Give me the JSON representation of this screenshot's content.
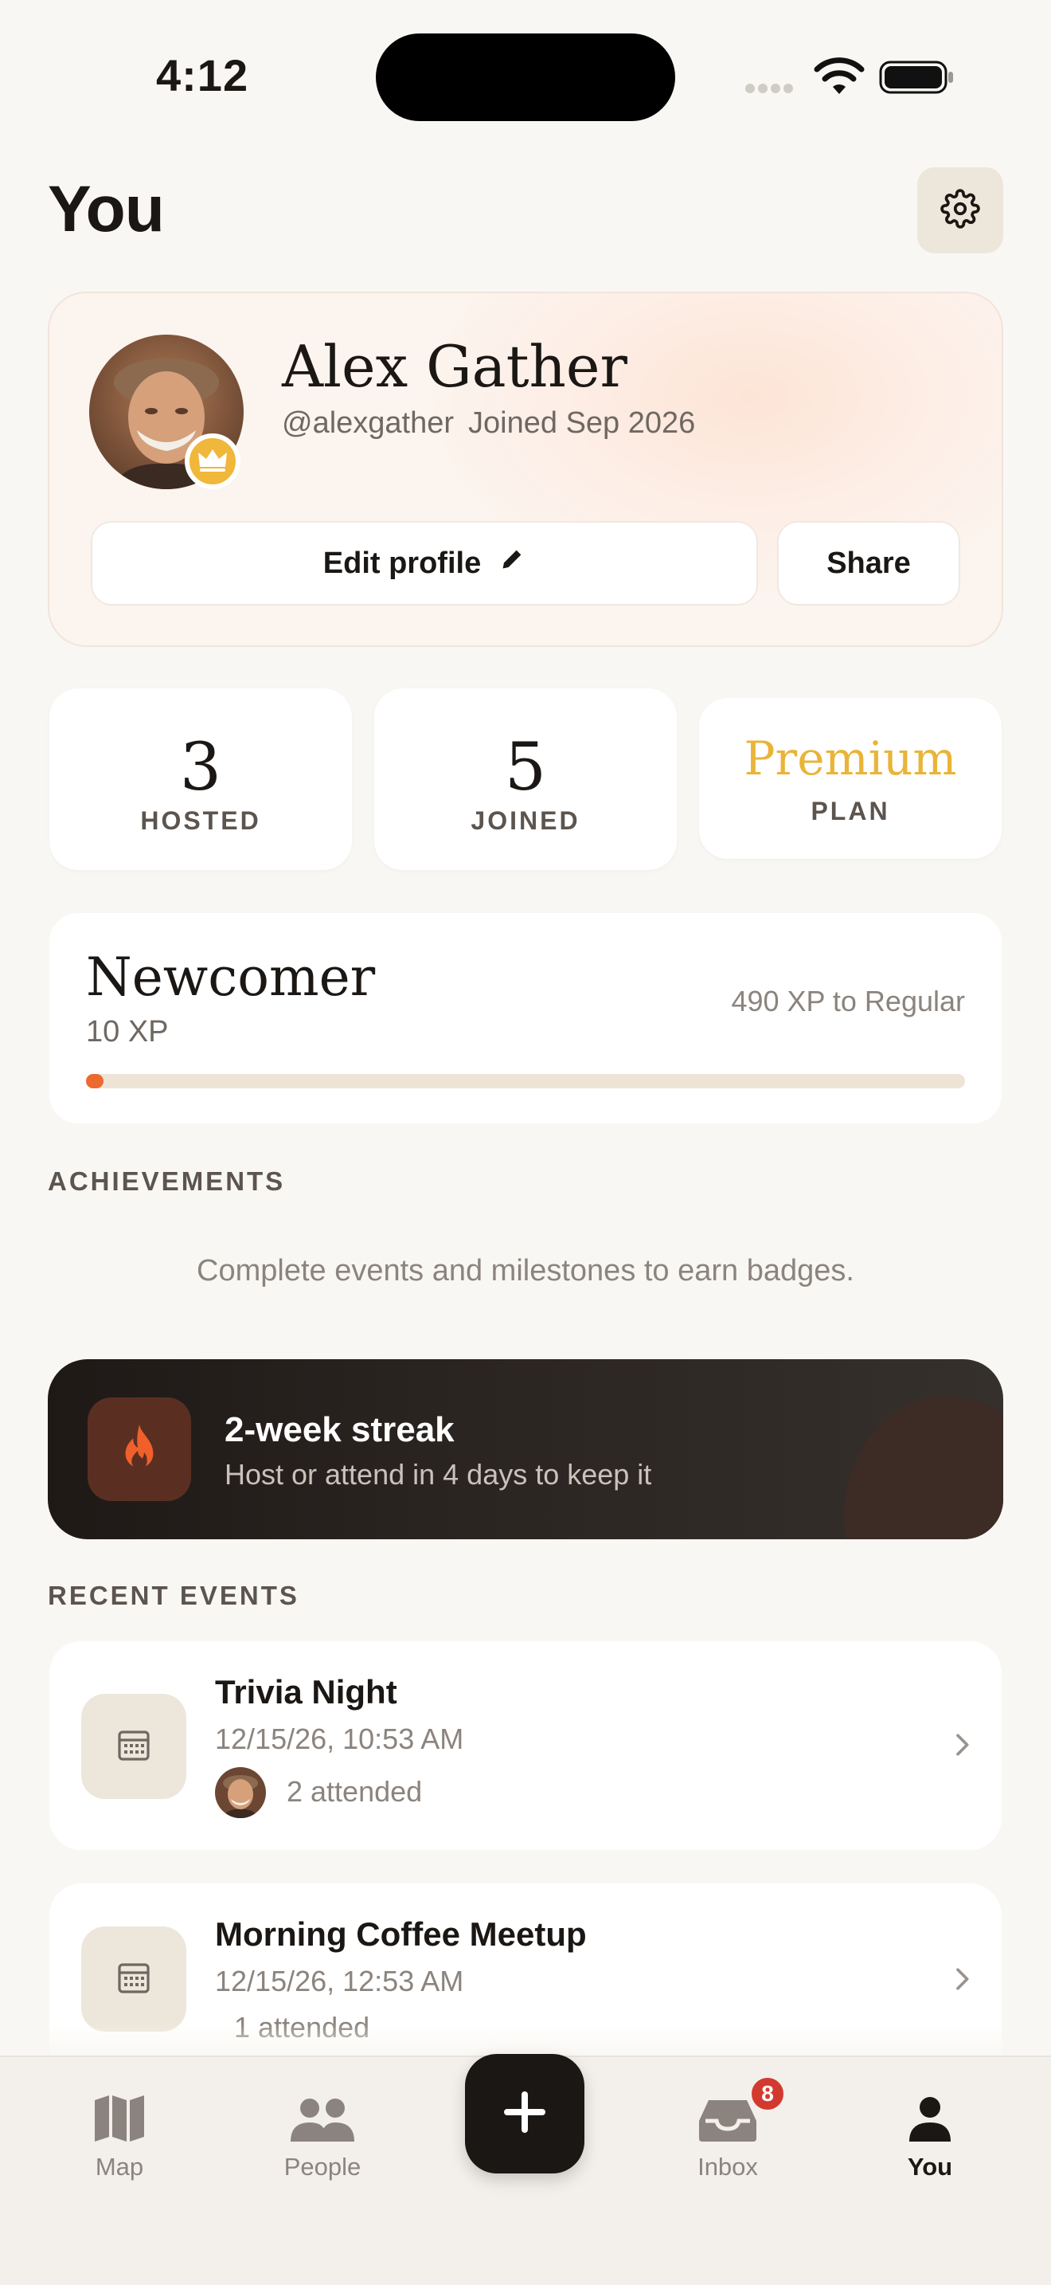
{
  "status_bar": {
    "time": "4:12"
  },
  "header": {
    "title": "You"
  },
  "profile": {
    "name": "Alex Gather",
    "handle": "@alexgather",
    "joined": "Joined Sep 2026",
    "edit_label": "Edit profile",
    "share_label": "Share"
  },
  "stats": [
    {
      "value": "3",
      "label": "HOSTED"
    },
    {
      "value": "5",
      "label": "JOINED"
    },
    {
      "value": "Premium",
      "label": "PLAN"
    }
  ],
  "level": {
    "name": "Newcomer",
    "xp": "10 XP",
    "next": "490 XP to Regular",
    "progress": 0.02
  },
  "achievements": {
    "label": "ACHIEVEMENTS",
    "empty_text": "Complete events and milestones to earn badges."
  },
  "streak": {
    "title": "2-week streak",
    "subtitle": "Host or attend in 4 days to keep it"
  },
  "recent": {
    "label": "RECENT EVENTS",
    "events": [
      {
        "title": "Trivia Night",
        "date": "12/15/26, 10:53 AM",
        "attended": "2 attended"
      },
      {
        "title": "Morning Coffee Meetup",
        "date": "12/15/26, 12:53 AM",
        "attended": "1 attended"
      }
    ]
  },
  "tabs": {
    "map": "Map",
    "people": "People",
    "inbox": "Inbox",
    "inbox_badge": "8",
    "you": "You"
  },
  "colors": {
    "accent": "#ec6a2e",
    "premium": "#e9b438",
    "badge": "#d33a2f"
  }
}
